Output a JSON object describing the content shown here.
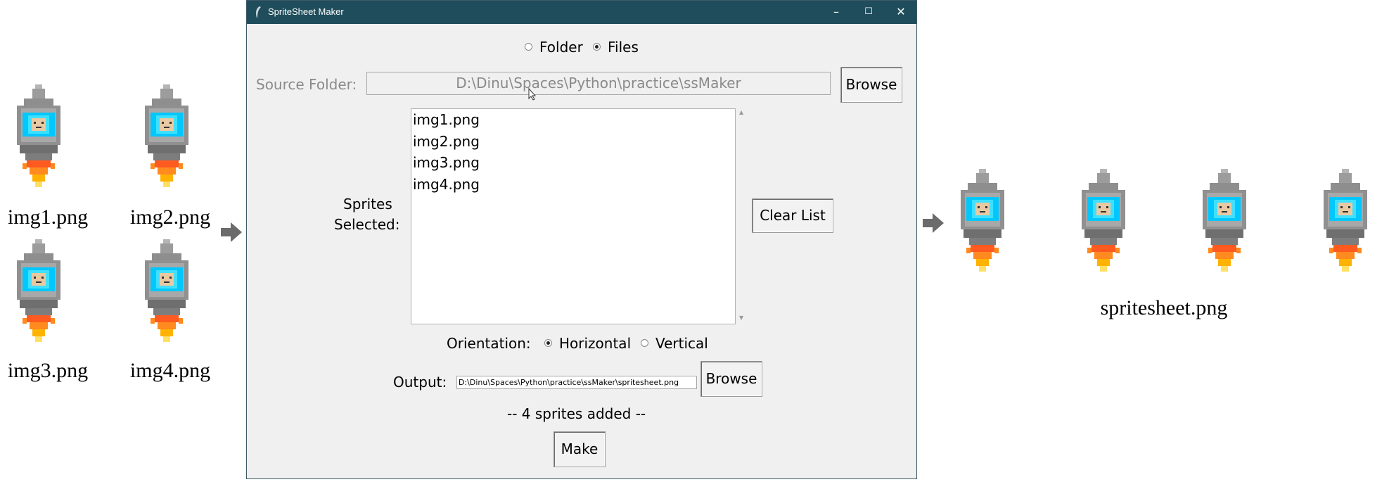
{
  "left_sprites": [
    {
      "caption": "img1.png"
    },
    {
      "caption": "img2.png"
    },
    {
      "caption": "img3.png"
    },
    {
      "caption": "img4.png"
    }
  ],
  "output_caption": "spritesheet.png",
  "window": {
    "title": "SpriteSheet Maker",
    "mode": {
      "folder_label": "Folder",
      "files_label": "Files",
      "selected": "Files"
    },
    "source": {
      "label": "Source Folder:",
      "value": "D:\\Dinu\\Spaces\\Python\\practice\\ssMaker",
      "browse_label": "Browse"
    },
    "sprites": {
      "label_line1": "Sprites",
      "label_line2": "Selected:",
      "items": [
        "img1.png",
        "img2.png",
        "img3.png",
        "img4.png"
      ],
      "clear_label": "Clear List"
    },
    "orientation": {
      "label": "Orientation:",
      "horizontal_label": "Horizontal",
      "vertical_label": "Vertical",
      "selected": "Horizontal"
    },
    "output": {
      "label": "Output:",
      "value": "D:\\Dinu\\Spaces\\Python\\practice\\ssMaker\\spritesheet.png",
      "browse_label": "Browse"
    },
    "status": "-- 4 sprites added --",
    "make_label": "Make"
  },
  "colors": {
    "title_bar": "#1f4d5c",
    "window_bg": "#f0f0f0",
    "arrow": "#6b6b6b"
  },
  "icons": {
    "sprite": "rocket-robot-sprite-icon",
    "arrow": "arrow-right-icon"
  }
}
